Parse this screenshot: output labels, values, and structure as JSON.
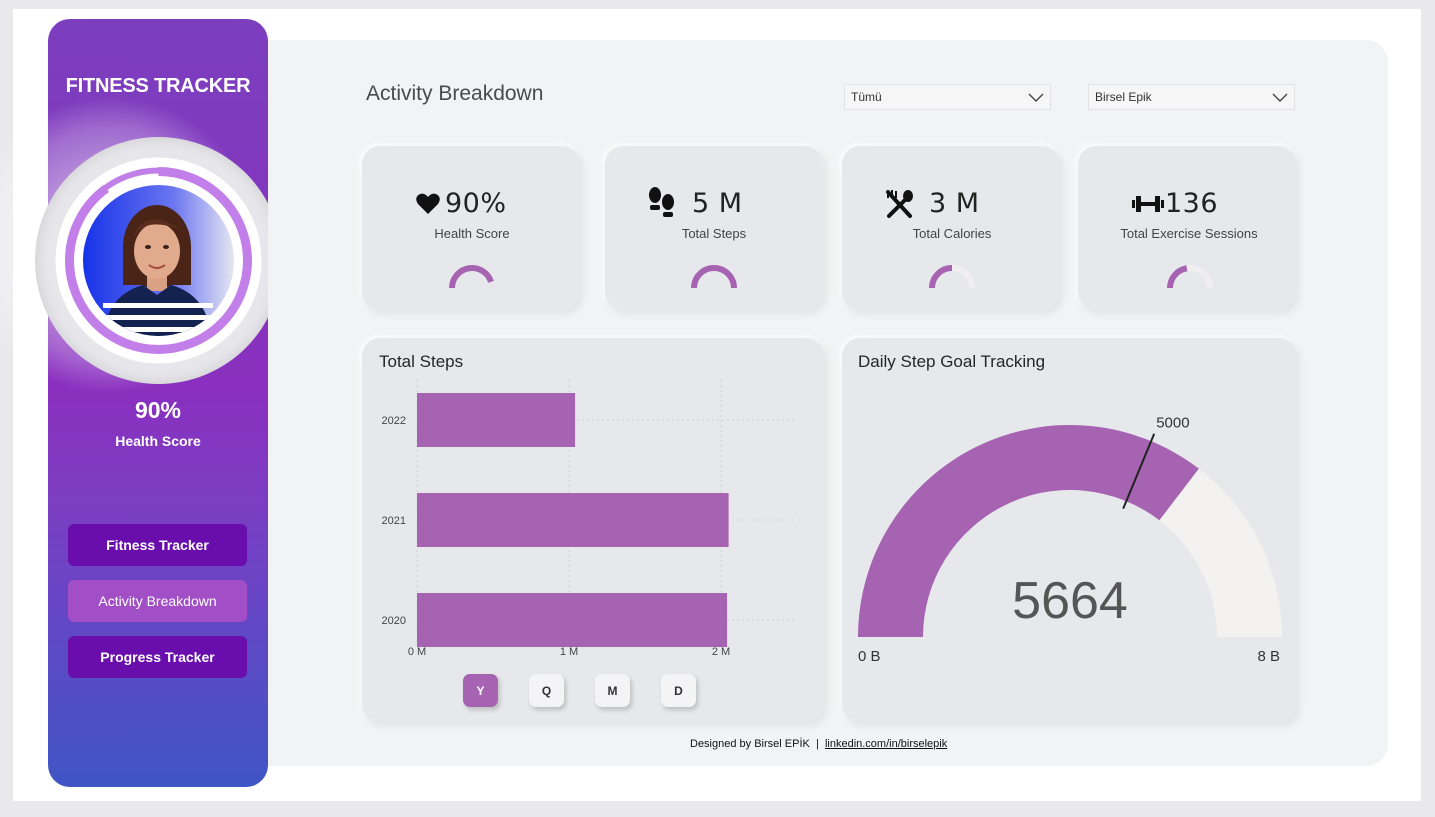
{
  "sidebar": {
    "title": "FITNESS TRACKER",
    "health_score_value": "90%",
    "health_score_label": "Health Score",
    "health_score_fraction": 0.9,
    "nav": [
      {
        "label": "Fitness Tracker",
        "active": false
      },
      {
        "label": "Activity Breakdown",
        "active": true
      },
      {
        "label": "Progress Tracker",
        "active": false
      }
    ]
  },
  "header": {
    "title": "Activity Breakdown",
    "filter1_value": "Tümü",
    "filter2_value": "Birsel Epik"
  },
  "kpis": [
    {
      "icon": "heart-icon",
      "value": "90%",
      "label": "Health Score",
      "gauge_fraction": 0.9
    },
    {
      "icon": "footprints-icon",
      "value": "5 M",
      "label": "Total Steps",
      "gauge_fraction": 1.0
    },
    {
      "icon": "fork-spoon-icon",
      "value": "3 M",
      "label": "Total Calories",
      "gauge_fraction": 0.5
    },
    {
      "icon": "dumbbell-icon",
      "value": "136",
      "label": "Total Exercise Sessions",
      "gauge_fraction": 0.45
    }
  ],
  "steps_chart": {
    "title": "Total Steps",
    "time_buttons": [
      "Y",
      "Q",
      "M",
      "D"
    ],
    "active_button": "Y"
  },
  "chart_data": {
    "type": "bar",
    "orientation": "horizontal",
    "categories": [
      "2022",
      "2021",
      "2020"
    ],
    "values": [
      1.04,
      2.05,
      2.04
    ],
    "x_ticks": [
      "0 M",
      "1 M",
      "2 M"
    ],
    "xlim": [
      0,
      2.5
    ],
    "color": "#a563b1",
    "grid": true
  },
  "goal_gauge": {
    "title": "Daily Step Goal Tracking",
    "value_label": "5664",
    "target_label": "5000",
    "min_label": "0 B",
    "max_label": "8 B",
    "value": 5664,
    "target": 5000,
    "max": 8000,
    "fill_color": "#a563b1",
    "track_color": "#f4f2f0"
  },
  "footer": {
    "credit": "Designed by Birsel EPİK",
    "separator": "|",
    "link": "linkedin.com/in/birselepik"
  },
  "colors": {
    "accent": "#a563b1",
    "nav_button": "#6a0dad",
    "nav_active": "#a24ec6"
  }
}
